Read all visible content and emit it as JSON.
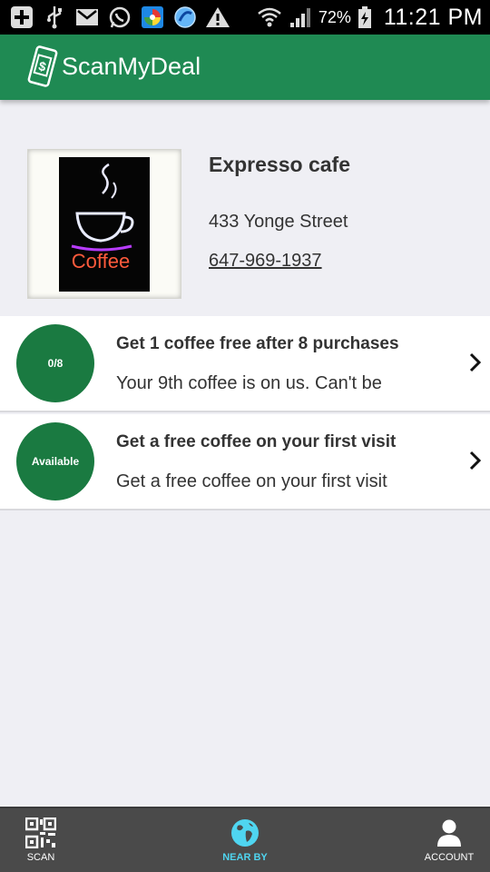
{
  "status_bar": {
    "battery": "72%",
    "time": "11:21 PM",
    "icons": [
      "add-icon",
      "usb-icon",
      "gmail-icon",
      "whatsapp-icon",
      "photos-icon",
      "browser-icon",
      "warning-icon",
      "wifi-icon",
      "signal-icon",
      "battery-charging-icon"
    ]
  },
  "app_bar": {
    "title": "ScanMyDeal",
    "color": "#1f8a53"
  },
  "store": {
    "name": "Expresso cafe",
    "address": "433 Yonge Street",
    "phone": "647-969-1937",
    "photo_text": "Coffee"
  },
  "deals": [
    {
      "badge": "0/8",
      "title": "Get 1 coffee free after 8 purchases",
      "description": "Your 9th coffee is on us. Can't be",
      "badge_color": "#1a7a41"
    },
    {
      "badge": "Available",
      "title": "Get a free coffee on your first visit",
      "description": "Get a free coffee on your first visit",
      "badge_color": "#1a7a41"
    }
  ],
  "bottom_nav": {
    "items": [
      {
        "label": "SCAN",
        "icon": "qr-code-icon",
        "active": false
      },
      {
        "label": "NEAR BY",
        "icon": "globe-icon",
        "active": true
      },
      {
        "label": "ACCOUNT",
        "icon": "user-icon",
        "active": false
      }
    ],
    "active_color": "#4fd5f0"
  }
}
